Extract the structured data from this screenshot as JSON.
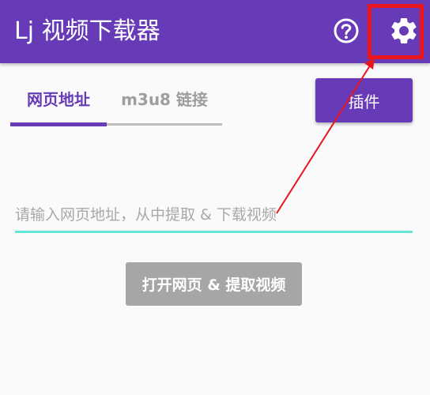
{
  "app_bar": {
    "title": "Lj 视频下载器",
    "background_color": "#673ab7",
    "help_icon": "help-circle-icon",
    "settings_icon": "gear-icon"
  },
  "tabs": [
    {
      "label": "网页地址",
      "selected": true
    },
    {
      "label": "m3u8 链接",
      "selected": false
    }
  ],
  "plugin_button": {
    "label": "插件"
  },
  "url_input": {
    "value": "",
    "placeholder": "请输入网页地址，从中提取 & 下载视频"
  },
  "open_button": {
    "label": "打开网页 & 提取视频",
    "enabled": false
  },
  "annotation": {
    "highlight_color": "#e8141e",
    "target": "settings-button"
  },
  "colors": {
    "accent": "#673ab7",
    "input_underline": "#64e5d6",
    "disabled_button": "#a6a6a6"
  }
}
